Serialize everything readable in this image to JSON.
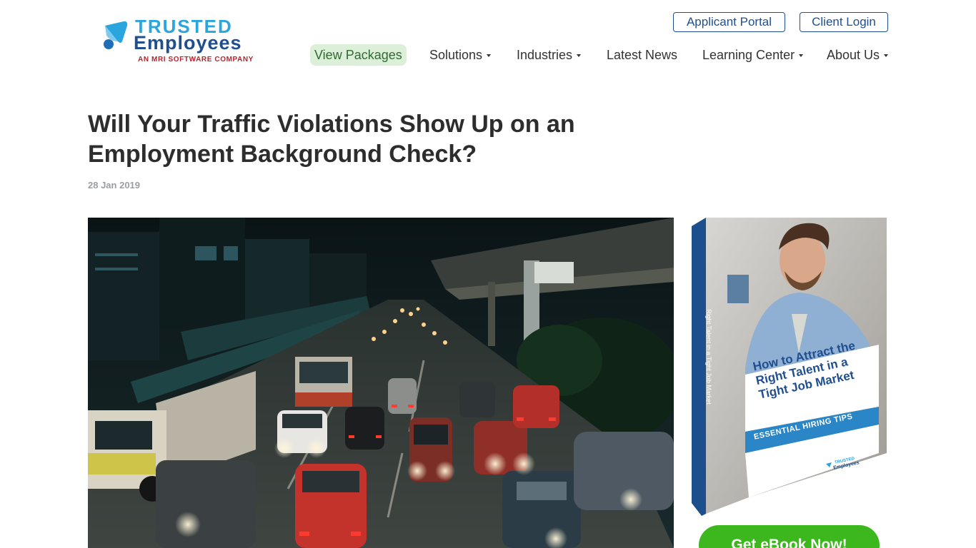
{
  "header": {
    "logo": {
      "line1": "TRUSTED",
      "line2": "Employees",
      "tagline": "AN MRI SOFTWARE COMPANY"
    },
    "top_buttons": {
      "applicant_portal": "Applicant Portal",
      "client_login": "Client Login"
    },
    "nav": {
      "view_packages": "View Packages",
      "solutions": "Solutions",
      "industries": "Industries",
      "latest_news": "Latest News",
      "learning_center": "Learning Center",
      "about_us": "About Us"
    }
  },
  "article": {
    "title": "Will Your Traffic Violations Show Up on an Employment Background Check?",
    "date": "28 Jan 2019",
    "hero_image_icon": "traffic-jam-photo"
  },
  "sidebar": {
    "ebook": {
      "title": "How to Attract the Right Talent in a Tight Job Market",
      "banner": "ESSENTIAL HIRING TIPS",
      "spine": "Right Talent in a Tight Job Market",
      "brand_line1": "TRUSTED",
      "brand_line2": "Employees"
    },
    "cta": "Get eBook Now!"
  },
  "colors": {
    "brand_blue": "#1f4f8f",
    "brand_light_blue": "#2aa5dd",
    "brand_red": "#b5252d",
    "cta_green": "#3cb81e",
    "nav_highlight": "#dcefd8"
  }
}
